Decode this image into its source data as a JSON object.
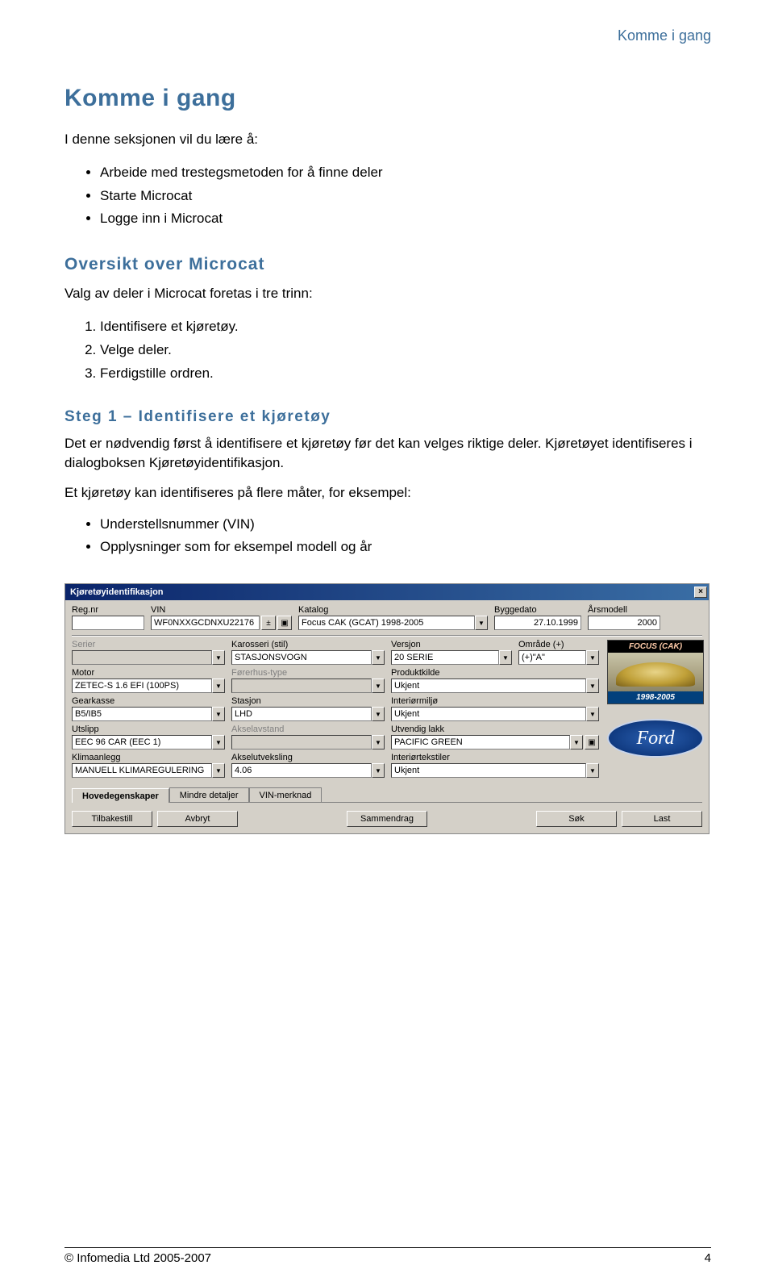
{
  "header": {
    "section": "Komme i gang"
  },
  "title": "Komme i gang",
  "intro": "I denne seksjonen vil du lære å:",
  "intro_bullets": [
    "Arbeide med trestegsmetoden for å finne deler",
    "Starte Microcat",
    "Logge inn i Microcat"
  ],
  "section1": {
    "heading": "Oversikt over Microcat",
    "lead": "Valg av deler i Microcat foretas i tre trinn:",
    "items": [
      "Identifisere et kjøretøy.",
      "Velge deler.",
      "Ferdigstille ordren."
    ]
  },
  "section2": {
    "heading": "Steg 1 – Identifisere et kjøretøy",
    "p1": "Det er nødvendig først å identifisere et kjøretøy før det kan velges riktige deler. Kjøretøyet identifiseres i dialogboksen Kjøretøyidentifikasjon.",
    "p2": "Et kjøretøy kan identifiseres på flere måter, for eksempel:",
    "bullets": [
      "Understellsnummer (VIN)",
      "Opplysninger som for eksempel modell og år"
    ]
  },
  "dialog": {
    "title": "Kjøretøyidentifikasjon",
    "row1": {
      "regnr": {
        "label": "Reg.nr",
        "value": ""
      },
      "vin": {
        "label": "VIN",
        "value": "WF0NXXGCDNXU22176"
      },
      "katalog": {
        "label": "Katalog",
        "value": "Focus CAK (GCAT) 1998-2005"
      },
      "byggedato": {
        "label": "Byggedato",
        "value": "27.10.1999"
      },
      "arsmodell": {
        "label": "Årsmodell",
        "value": "2000"
      }
    },
    "row2": {
      "serier": {
        "label": "Serier",
        "value": ""
      },
      "karosseri": {
        "label": "Karosseri (stil)",
        "value": "STASJONSVOGN"
      },
      "versjon": {
        "label": "Versjon",
        "value": "20 SERIE"
      },
      "omrade": {
        "label": "Område (+)",
        "value": "(+)\"A\""
      }
    },
    "row3": {
      "motor": {
        "label": "Motor",
        "value": "ZETEC-S 1.6 EFI (100PS)"
      },
      "forerhus": {
        "label": "Førerhus-type",
        "value": ""
      },
      "produktkilde": {
        "label": "Produktkilde",
        "value": "Ukjent"
      }
    },
    "row4": {
      "gearkasse": {
        "label": "Gearkasse",
        "value": "B5/IB5"
      },
      "stasjon": {
        "label": "Stasjon",
        "value": "LHD"
      },
      "interiormiljo": {
        "label": "Interiørmiljø",
        "value": "Ukjent"
      }
    },
    "row5": {
      "utslipp": {
        "label": "Utslipp",
        "value": "EEC 96 CAR (EEC 1)"
      },
      "akselavstand": {
        "label": "Akselavstand",
        "value": ""
      },
      "utvendiglakk": {
        "label": "Utvendig lakk",
        "value": "PACIFIC GREEN"
      }
    },
    "row6": {
      "klimaanlegg": {
        "label": "Klimaanlegg",
        "value": "MANUELL KLIMAREGULERING"
      },
      "akselutveksling": {
        "label": "Akselutveksling",
        "value": "4.06"
      },
      "interiortekstiler": {
        "label": "Interiørtekstiler",
        "value": "Ukjent"
      }
    },
    "tabs": [
      "Hovedegenskaper",
      "Mindre detaljer",
      "VIN-merknad"
    ],
    "footer": {
      "tilbakestill": "Tilbakestill",
      "avbryt": "Avbryt",
      "sammendrag": "Sammendrag",
      "sok": "Søk",
      "last": "Last"
    },
    "carbox": {
      "top": "FOCUS (CAK)",
      "bottom": "1998-2005"
    },
    "logo": "Ford"
  },
  "footer": {
    "copyright": "© Infomedia Ltd 2005-2007",
    "page": "4"
  }
}
